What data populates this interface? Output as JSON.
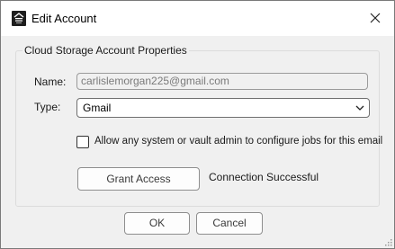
{
  "window": {
    "title": "Edit Account",
    "icon": "storage-server-icon",
    "close_icon": "close-icon"
  },
  "group": {
    "title": "Cloud Storage Account Properties"
  },
  "form": {
    "name_label": "Name:",
    "name_value": "carlislemorgan225@gmail.com",
    "type_label": "Type:",
    "type_value": "Gmail",
    "allow_admin_label": "Allow any system or vault admin to configure jobs for this email",
    "allow_admin_checked": false
  },
  "actions": {
    "grant_access_label": "Grant Access",
    "status_text": "Connection Successful"
  },
  "footer": {
    "ok_label": "OK",
    "cancel_label": "Cancel"
  },
  "colors": {
    "dialog_bg": "#f0f0f0",
    "titlebar_bg": "#ffffff",
    "border": "#7a7a7a",
    "disabled_text": "#7a7a7a"
  }
}
